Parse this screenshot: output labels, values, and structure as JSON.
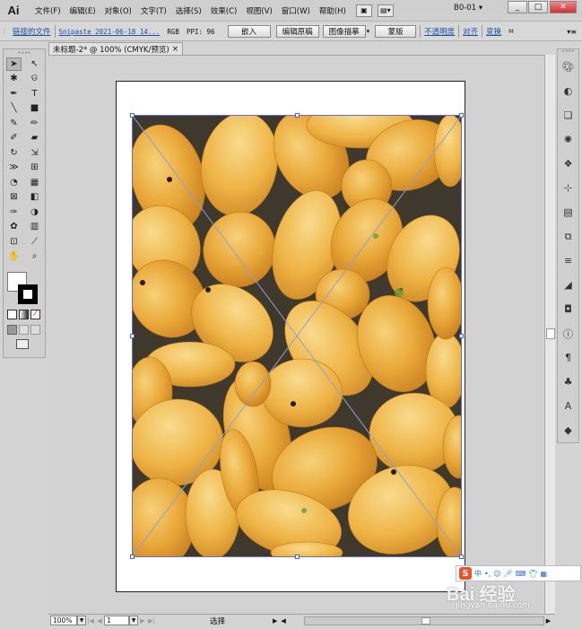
{
  "app": {
    "logo": "Ai"
  },
  "menu": [
    "文件(F)",
    "编辑(E)",
    "对象(O)",
    "文字(T)",
    "选择(S)",
    "效果(C)",
    "视图(V)",
    "窗口(W)",
    "帮助(H)"
  ],
  "workspace": "B0-01",
  "window_buttons": {
    "minimize": "_",
    "maximize": "□",
    "close": "✕"
  },
  "control_bar": {
    "linked_file_label": "链接的文件",
    "file_name": "Snipaste_2021-06-18_14...",
    "color_mode": "RGB",
    "ppi_label": "PPI: 96",
    "embed": "嵌入",
    "edit_original": "编辑原稿",
    "image_trace": "图像描摹",
    "mask": "蒙版",
    "opacity": "不透明度",
    "align": "对齐",
    "transform": "变换"
  },
  "document": {
    "tab_title": "未标题-2* @ 100% (CMYK/预览)",
    "close": "×"
  },
  "status_bar": {
    "zoom": "100%",
    "page": "1",
    "status": "选择"
  },
  "ime": {
    "brand": "S",
    "lang": "中"
  },
  "watermark": {
    "main": "Bai 经验",
    "sub": "jingyan.baidu.com"
  },
  "colors": {
    "selection": "#5b6fd6",
    "mango": "#e9a93a",
    "background": "#d4d4d4"
  }
}
